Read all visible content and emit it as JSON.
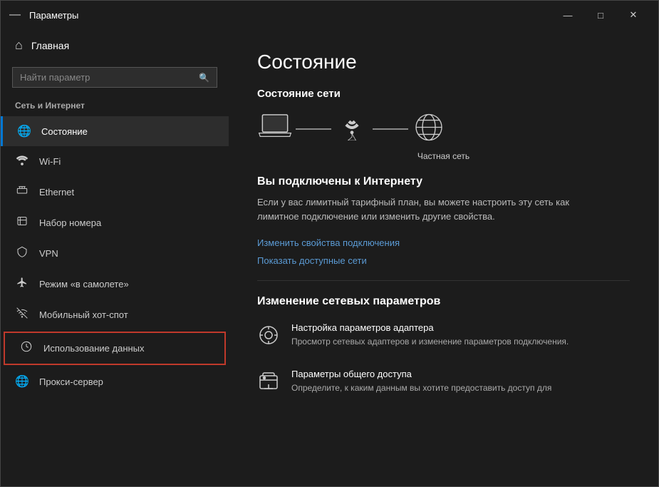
{
  "window": {
    "title": "Параметры",
    "controls": {
      "minimize": "—",
      "maximize": "□",
      "close": "✕"
    }
  },
  "sidebar": {
    "back_label": "←",
    "home_label": "Главная",
    "search_placeholder": "Найти параметр",
    "section_label": "Сеть и Интернет",
    "nav_items": [
      {
        "id": "status",
        "icon": "🌐",
        "label": "Состояние",
        "active": true
      },
      {
        "id": "wifi",
        "icon": "📶",
        "label": "Wi-Fi",
        "active": false
      },
      {
        "id": "ethernet",
        "icon": "🖥",
        "label": "Ethernet",
        "active": false
      },
      {
        "id": "dialup",
        "icon": "📠",
        "label": "Набор номера",
        "active": false
      },
      {
        "id": "vpn",
        "icon": "🔒",
        "label": "VPN",
        "active": false
      },
      {
        "id": "airplane",
        "icon": "✈",
        "label": "Режим «в самолете»",
        "active": false
      },
      {
        "id": "hotspot",
        "icon": "📡",
        "label": "Мобильный хот-спот",
        "active": false
      },
      {
        "id": "data_usage",
        "icon": "📊",
        "label": "Использование данных",
        "active": false,
        "highlighted": true
      },
      {
        "id": "proxy",
        "icon": "🌐",
        "label": "Прокси-сервер",
        "active": false
      }
    ]
  },
  "main": {
    "title": "Состояние",
    "network_status_heading": "Состояние сети",
    "network_label": "Частная сеть",
    "connected_heading": "Вы подключены к Интернету",
    "connected_desc": "Если у вас лимитный тарифный план, вы можете настроить эту сеть как лимитное подключение или изменить другие свойства.",
    "link_properties": "Изменить свойства подключения",
    "link_available": "Показать доступные сети",
    "settings_section_title": "Изменение сетевых параметров",
    "settings_items": [
      {
        "id": "adapter",
        "icon": "🔧",
        "title": "Настройка параметров адаптера",
        "desc": "Просмотр сетевых адаптеров и изменение параметров подключения."
      },
      {
        "id": "sharing",
        "icon": "🖨",
        "title": "Параметры общего доступа",
        "desc": "Определите, к каким данным вы хотите предоставить доступ для"
      }
    ]
  }
}
